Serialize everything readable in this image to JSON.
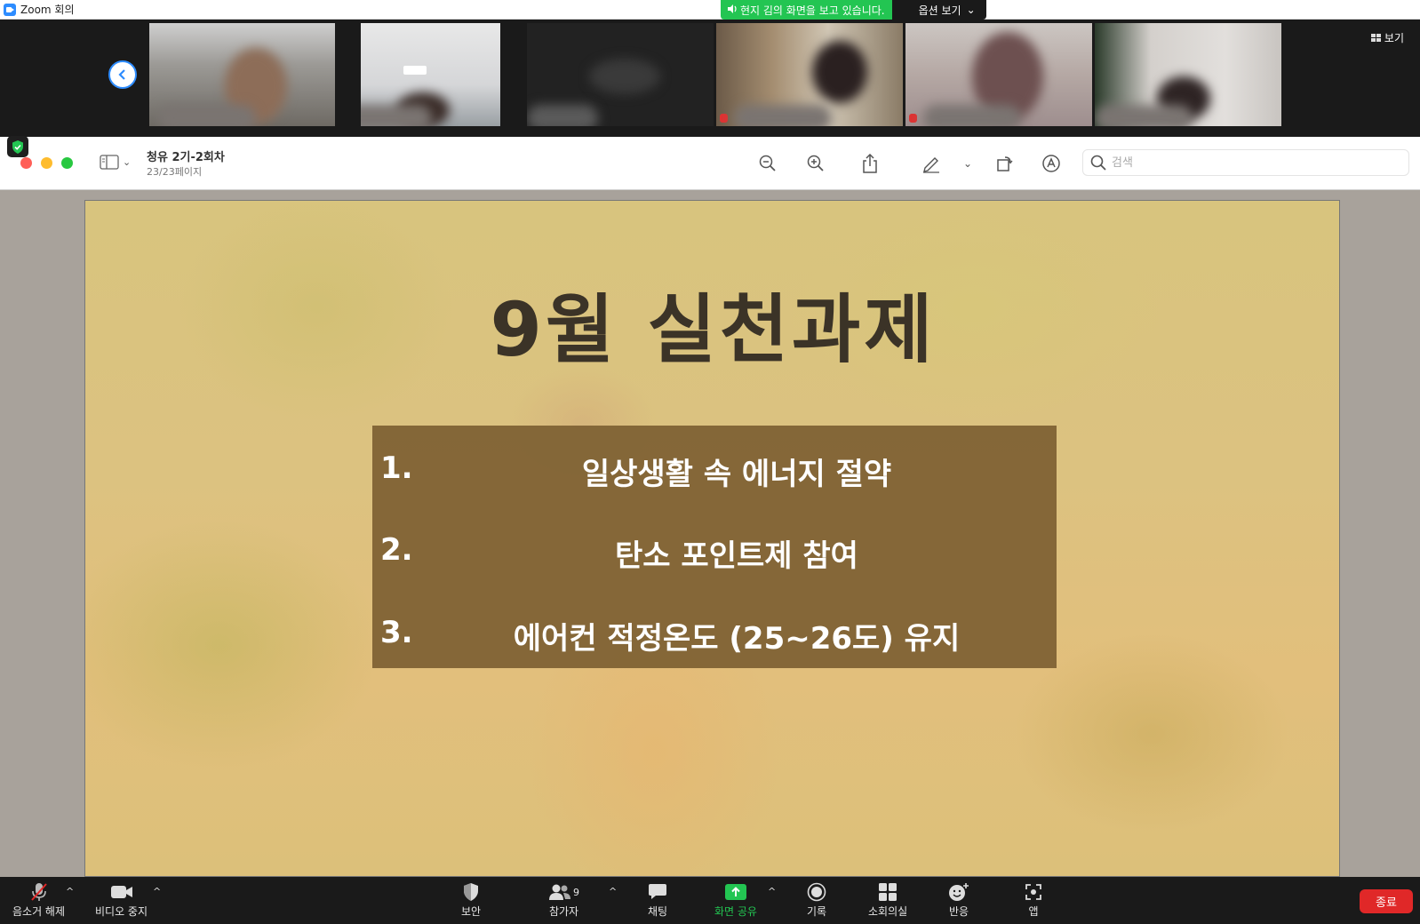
{
  "app": {
    "title": "Zoom 회의"
  },
  "share_banner": {
    "status": "현지 김의 화면을 보고 있습니다.",
    "options_label": "옵션 보기"
  },
  "gallery": {
    "view_label": "보기",
    "participant_tiles": 6
  },
  "viewer": {
    "doc_title": "청유 2기-2회차",
    "page_indicator": "23/23페이지",
    "search_placeholder": "검색"
  },
  "slide": {
    "title": "9월 실천과제",
    "tasks": [
      {
        "num": "1.",
        "text": "일상생활 속 에너지 절약"
      },
      {
        "num": "2.",
        "text": "탄소 포인트제 참여"
      },
      {
        "num": "3.",
        "text": "에어컨 적정온도 (25~26도) 유지"
      }
    ]
  },
  "toolbar": {
    "unmute": "음소거 해제",
    "stop_video": "비디오 중지",
    "security": "보안",
    "participants": "참가자",
    "participants_count": "9",
    "chat": "채팅",
    "share_screen": "화면 공유",
    "record": "기록",
    "breakout": "소회의실",
    "reactions": "반응",
    "apps": "앱",
    "end": "종료"
  },
  "colors": {
    "zoom_blue": "#2d8cff",
    "share_green": "#23c552",
    "end_red": "#e02828"
  }
}
